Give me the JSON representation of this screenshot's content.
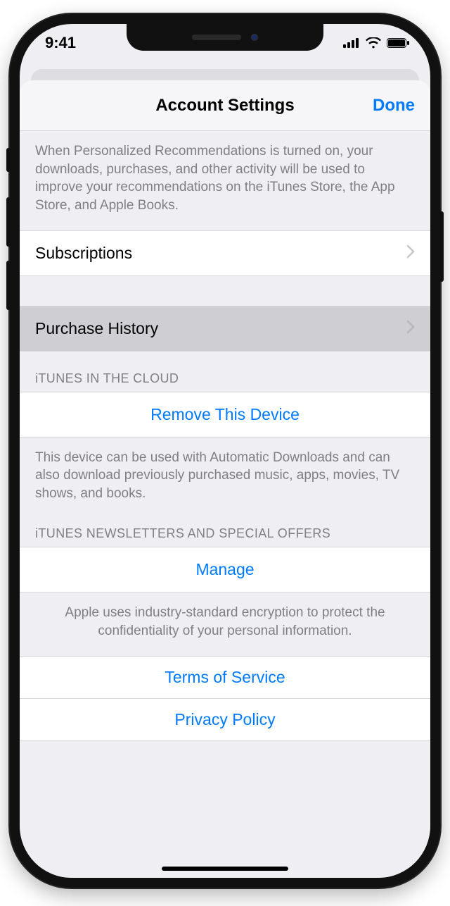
{
  "status": {
    "time": "9:41"
  },
  "nav": {
    "title": "Account Settings",
    "done": "Done"
  },
  "notes": {
    "personalized": "When Personalized Recommendations is turned on, your downloads, purchases, and other activity will be used to improve your recommendations on the iTunes Store, the App Store, and Apple Books.",
    "cloud": "This device can be used with Automatic Downloads and can also download previously purchased music, apps, movies, TV shows, and books.",
    "encryption": "Apple uses industry-standard encryption to protect the confidentiality of your personal information."
  },
  "rows": {
    "subscriptions": "Subscriptions",
    "purchase_history": "Purchase History",
    "itunes_cloud_header": "iTUNES IN THE CLOUD",
    "remove_device": "Remove This Device",
    "newsletters_header": "iTUNES NEWSLETTERS AND SPECIAL OFFERS",
    "manage": "Manage",
    "terms": "Terms of Service",
    "privacy": "Privacy Policy"
  }
}
